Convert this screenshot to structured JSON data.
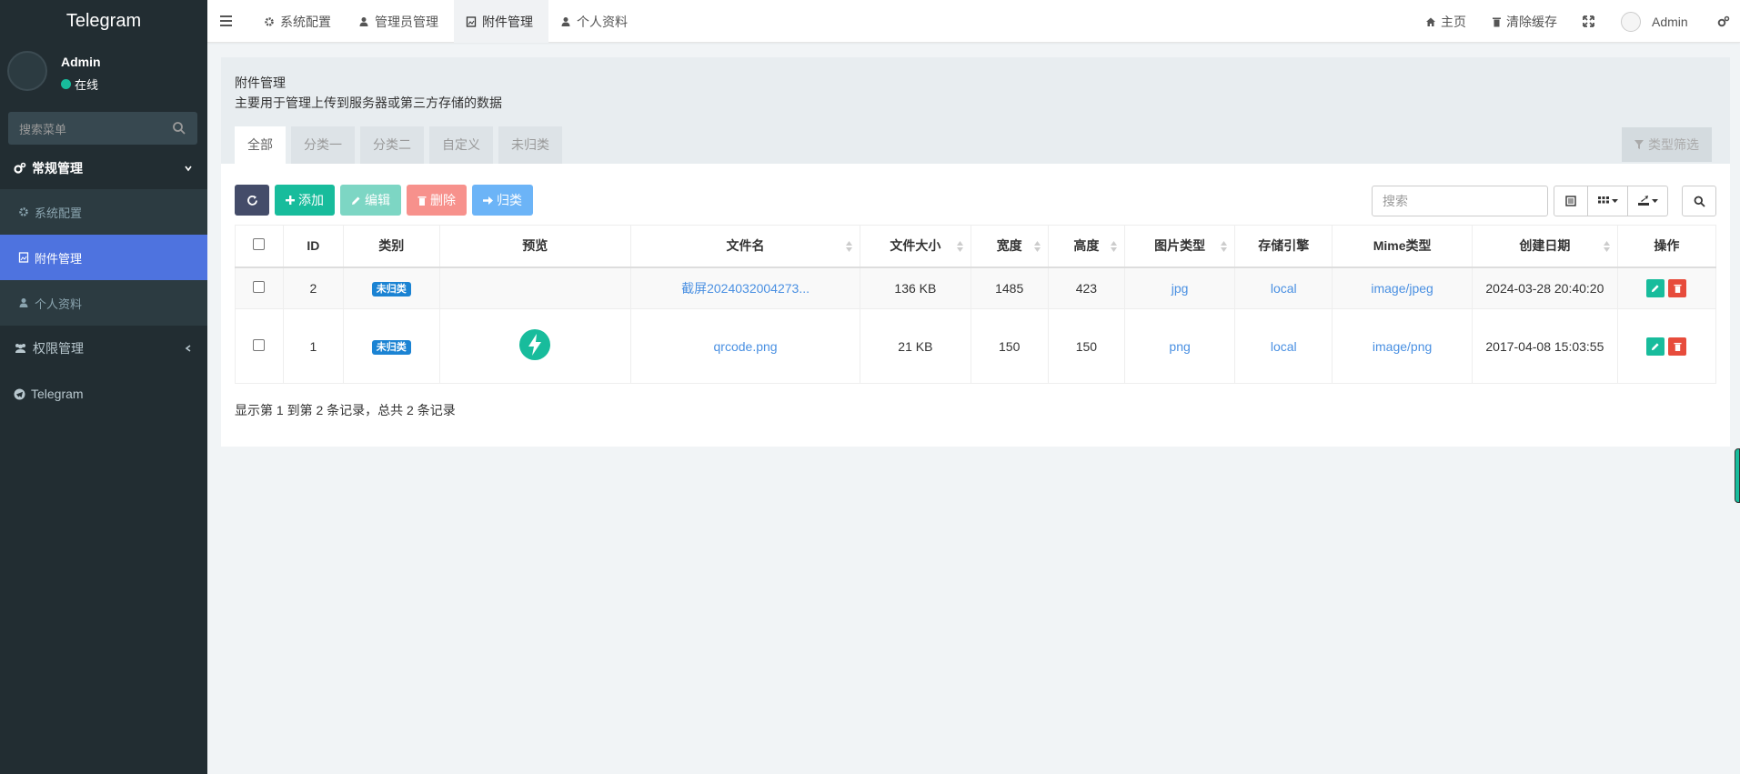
{
  "app": {
    "title": "Telegram"
  },
  "user": {
    "name": "Admin",
    "status": "在线"
  },
  "sidebar": {
    "search_placeholder": "搜索菜单",
    "groups": [
      {
        "label": "常规管理"
      },
      {
        "label": "权限管理"
      }
    ],
    "sub_items": [
      {
        "label": "系统配置"
      },
      {
        "label": "附件管理"
      },
      {
        "label": "个人资料"
      }
    ],
    "telegram_label": "Telegram"
  },
  "header": {
    "tabs": [
      {
        "label": "系统配置",
        "icon": "gear-icon"
      },
      {
        "label": "管理员管理",
        "icon": "user-icon"
      },
      {
        "label": "附件管理",
        "icon": "image-file-icon"
      },
      {
        "label": "个人资料",
        "icon": "user-icon"
      }
    ],
    "home_label": "主页",
    "clear_cache_label": "清除缓存",
    "admin_label": "Admin"
  },
  "page": {
    "title": "附件管理",
    "description": "主要用于管理上传到服务器或第三方存储的数据",
    "tabs": [
      "全部",
      "分类一",
      "分类二",
      "自定义",
      "未归类"
    ],
    "type_filter_label": "类型筛选",
    "toolbar": {
      "add": "添加",
      "edit": "编辑",
      "delete": "删除",
      "classify": "归类"
    },
    "search_placeholder": "搜索"
  },
  "table": {
    "columns": [
      "ID",
      "类别",
      "预览",
      "文件名",
      "文件大小",
      "宽度",
      "高度",
      "图片类型",
      "存储引擎",
      "Mime类型",
      "创建日期",
      "操作"
    ],
    "rows": [
      {
        "id": "2",
        "category": "未归类",
        "filename": "截屏2024032004273...",
        "size": "136 KB",
        "width": "1485",
        "height": "423",
        "imagetype": "jpg",
        "storage": "local",
        "mime": "image/jpeg",
        "created": "2024-03-28 20:40:20"
      },
      {
        "id": "1",
        "category": "未归类",
        "filename": "qrcode.png",
        "size": "21 KB",
        "width": "150",
        "height": "150",
        "imagetype": "png",
        "storage": "local",
        "mime": "image/png",
        "created": "2017-04-08 15:03:55"
      }
    ],
    "summary": "显示第 1 到第 2 条记录，总共 2 条记录"
  },
  "colors": {
    "sidebar": "#222d32",
    "active": "#4e73df",
    "success": "#18bc9c",
    "danger": "#e74c3c",
    "link": "#4a90e2"
  }
}
